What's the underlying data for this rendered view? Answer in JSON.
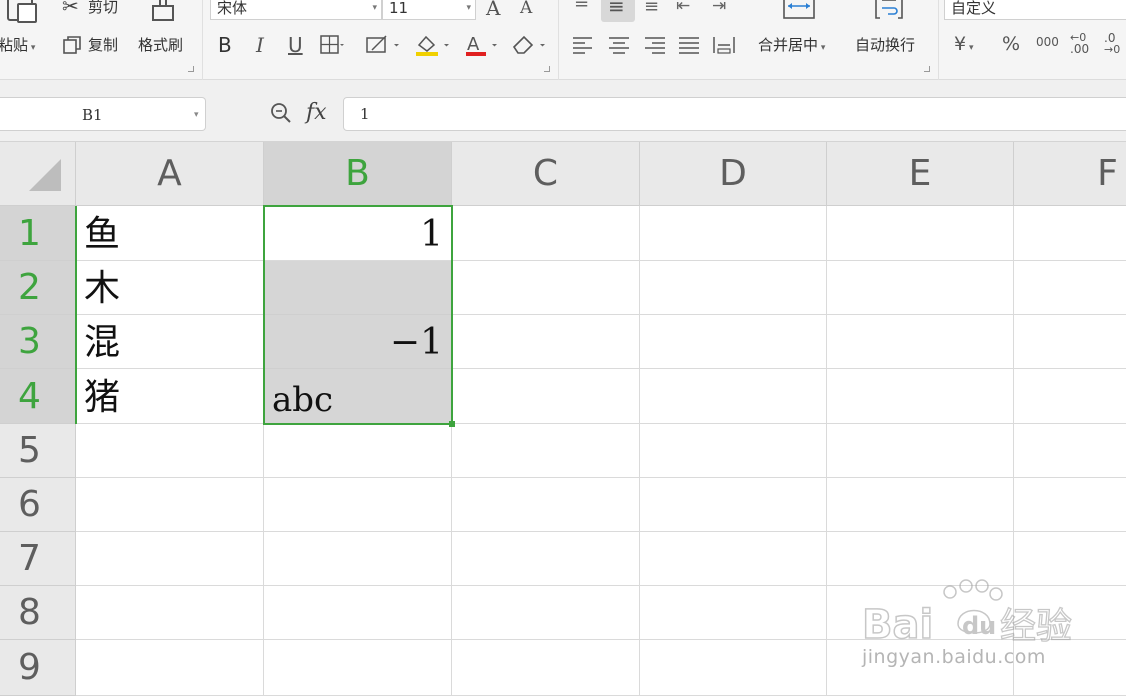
{
  "ribbon": {
    "paste_label": "粘贴",
    "cut_label": "剪切",
    "copy_label": "复制",
    "format_painter_label": "格式刷",
    "font_name": "宋体",
    "font_size": "11",
    "grow_font_glyph": "A",
    "shrink_font_glyph": "A",
    "bold_glyph": "B",
    "italic_glyph": "I",
    "underline_glyph": "U",
    "font_color_glyph": "A",
    "merge_center_label": "合并居中",
    "wrap_text_label": "自动换行",
    "number_format": "自定义",
    "currency_glyph": "¥",
    "percent_glyph": "%",
    "thousands_glyph": "000",
    "inc_decimal_glyph": ".00",
    "dec_decimal_glyph": ".0",
    "colors": {
      "font_color": "#e02020",
      "fill_color": "#f0d000"
    }
  },
  "formula_bar": {
    "name_box": "B1",
    "fx_label": "fx",
    "content": "1"
  },
  "sheet": {
    "columns": [
      "A",
      "B",
      "C",
      "D",
      "E",
      "F"
    ],
    "rows": [
      "1",
      "2",
      "3",
      "4",
      "5",
      "6",
      "7",
      "8",
      "9"
    ],
    "cells": {
      "A1": "鱼",
      "A2": "木",
      "A3": "混",
      "A4": "猪",
      "B1": "1",
      "B2": "",
      "B3": "−1",
      "B4": "abc"
    },
    "selection": "B1:B4",
    "accent_color": "#3ea43e"
  },
  "watermark": {
    "logo_text_a": "Bai",
    "logo_text_b": "du",
    "logo_text_c": "经验",
    "url": "jingyan.baidu.com"
  }
}
